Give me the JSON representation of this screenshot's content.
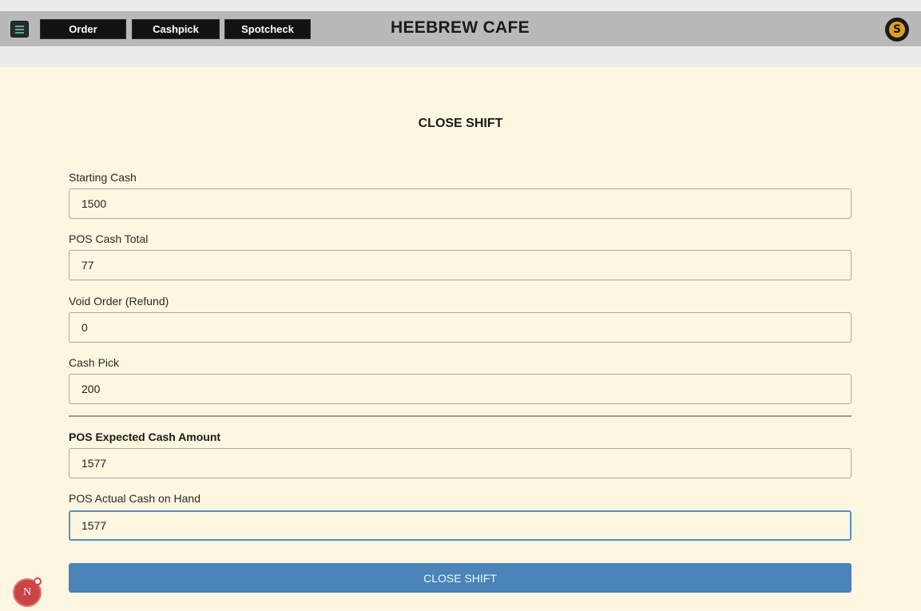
{
  "nav": {
    "menu_icon": "hamburger-icon",
    "buttons": [
      "Order",
      "Cashpick",
      "Spotcheck"
    ],
    "title": "HEEBREW CAFE",
    "logo_glyph": "S"
  },
  "form": {
    "heading": "CLOSE SHIFT",
    "fields": [
      {
        "label": "Starting Cash",
        "value": "1500"
      },
      {
        "label": "POS Cash Total",
        "value": "77"
      },
      {
        "label": "Void Order (Refund)",
        "value": "0"
      },
      {
        "label": "Cash Pick",
        "value": "200"
      },
      {
        "label": "POS Expected Cash Amount",
        "value": "1577"
      },
      {
        "label": "POS Actual Cash on Hand",
        "value": "1577"
      }
    ],
    "submit_label": "CLOSE SHIFT"
  },
  "badge": {
    "letter": "N"
  },
  "colors": {
    "background": "#fdf6e0",
    "navbar": "#b9b9b9",
    "nav_button": "#121212",
    "submit": "#4a84b8",
    "focus_border": "#5b8ec4",
    "badge": "#cc4444"
  }
}
